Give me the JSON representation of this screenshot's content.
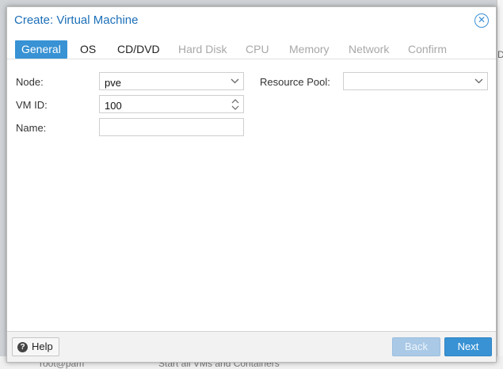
{
  "background": {
    "edge_text": "D:",
    "bottom_user": "root@pam",
    "bottom_task": "Start all VMs and Containers"
  },
  "window": {
    "title": "Create: Virtual Machine",
    "close_icon": "close-circle-icon"
  },
  "tabs": [
    {
      "label": "General",
      "state": "active"
    },
    {
      "label": "OS",
      "state": "enabled"
    },
    {
      "label": "CD/DVD",
      "state": "enabled"
    },
    {
      "label": "Hard Disk",
      "state": "disabled"
    },
    {
      "label": "CPU",
      "state": "disabled"
    },
    {
      "label": "Memory",
      "state": "disabled"
    },
    {
      "label": "Network",
      "state": "disabled"
    },
    {
      "label": "Confirm",
      "state": "disabled"
    }
  ],
  "form": {
    "node": {
      "label": "Node:",
      "value": "pve"
    },
    "vmid": {
      "label": "VM ID:",
      "value": "100"
    },
    "name": {
      "label": "Name:",
      "value": ""
    },
    "pool": {
      "label": "Resource Pool:",
      "value": ""
    }
  },
  "footer": {
    "help_label": "Help",
    "back_label": "Back",
    "next_label": "Next"
  },
  "colors": {
    "accent": "#3892d4",
    "title": "#1c6fb8"
  }
}
